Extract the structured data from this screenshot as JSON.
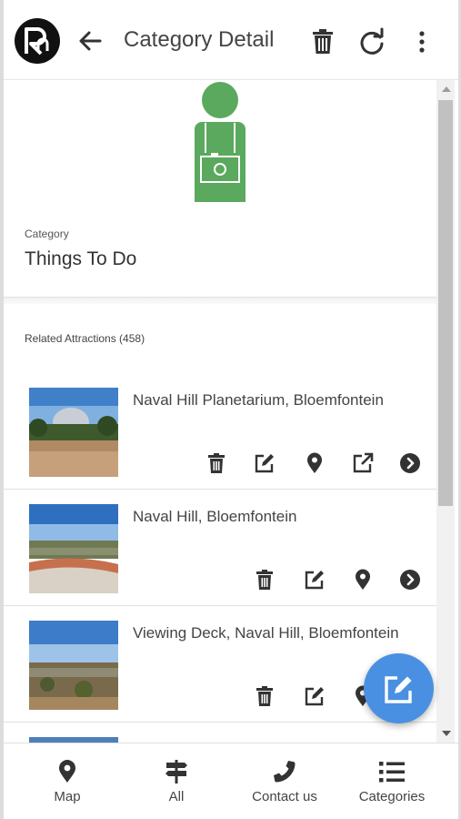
{
  "header": {
    "title": "Category Detail",
    "logo_icon": "rn-logo-icon",
    "back_icon": "arrow-left-icon",
    "delete_icon": "trash-icon",
    "refresh_icon": "refresh-icon",
    "more_icon": "more-vertical-icon"
  },
  "category": {
    "label": "Category",
    "value": "Things To Do",
    "icon": "tourist-camera-icon",
    "icon_color": "#5aa95e"
  },
  "related": {
    "label": "Related Attractions (458)"
  },
  "attractions": [
    {
      "title": "Naval Hill Planetarium, Bloemfontein",
      "actions": [
        "trash-icon",
        "edit-icon",
        "map-pin-icon",
        "external-link-icon",
        "chevron-right-circle-icon"
      ]
    },
    {
      "title": "Naval Hill, Bloemfontein",
      "actions": [
        "trash-icon",
        "edit-icon",
        "map-pin-icon",
        "chevron-right-circle-icon"
      ]
    },
    {
      "title": "Viewing Deck, Naval Hill, Bloemfontein",
      "actions": [
        "trash-icon",
        "edit-icon",
        "map-pin-icon"
      ]
    }
  ],
  "fab": {
    "icon": "edit-icon",
    "color": "#4a90e2"
  },
  "nav": [
    {
      "label": "Map",
      "icon": "map-pin-icon"
    },
    {
      "label": "All",
      "icon": "signpost-icon"
    },
    {
      "label": "Contact us",
      "icon": "phone-icon"
    },
    {
      "label": "Categories",
      "icon": "list-icon"
    }
  ],
  "colors": {
    "icon": "#333333",
    "accent": "#4a90e2"
  }
}
